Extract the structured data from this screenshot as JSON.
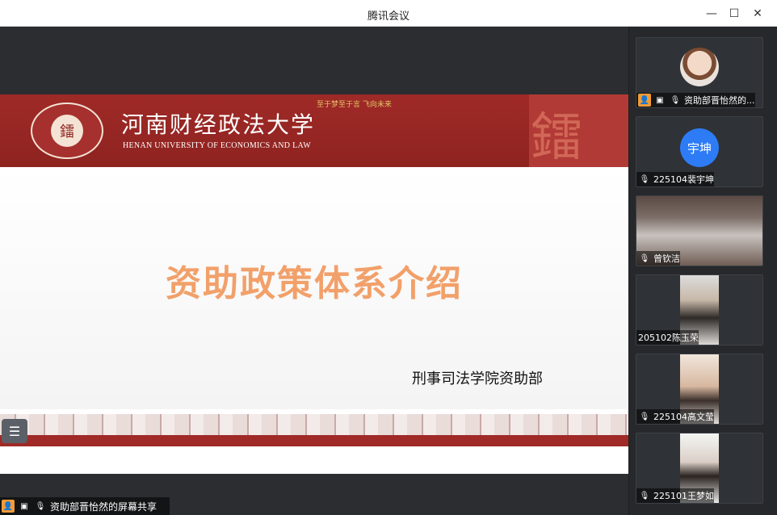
{
  "window": {
    "title": "腾讯会议",
    "minimize_glyph": "—",
    "maximize_glyph": "☐",
    "close_glyph": "✕"
  },
  "slide": {
    "university_cn": "河南财经政法大学",
    "university_en": "HENAN UNIVERSITY OF ECONOMICS AND LAW",
    "motto": "至于梦至于言 飞向未来",
    "main_title": "资助政策体系介绍",
    "subtitle": "刑事司法学院资助部",
    "logo_char": "鐳"
  },
  "share_bar": {
    "label": "资助部晋怡然的屏幕共享"
  },
  "participants": [
    {
      "name": "资助部晋怡然的...",
      "role": "host",
      "avatar": "photo"
    },
    {
      "name": "225104裴宇坤",
      "avatar_text": "宇坤"
    },
    {
      "name": "曾钦洁",
      "avatar": "video-room"
    },
    {
      "name": "205102陈玉荣",
      "avatar": "video-person"
    },
    {
      "name": "225104高文莹",
      "avatar": "video-person"
    },
    {
      "name": "225101王梦如",
      "avatar": "video-person"
    }
  ],
  "icons": {
    "host": "person-icon",
    "share": "screen-share-icon",
    "mic": "microphone-icon",
    "mic_muted": "microphone-muted-icon",
    "list": "list-icon"
  },
  "colors": {
    "banner_red": "#9f2a27",
    "title_orange": "#f2a06a",
    "host_badge": "#f29b35",
    "avatar_blue": "#2d7cf6"
  }
}
